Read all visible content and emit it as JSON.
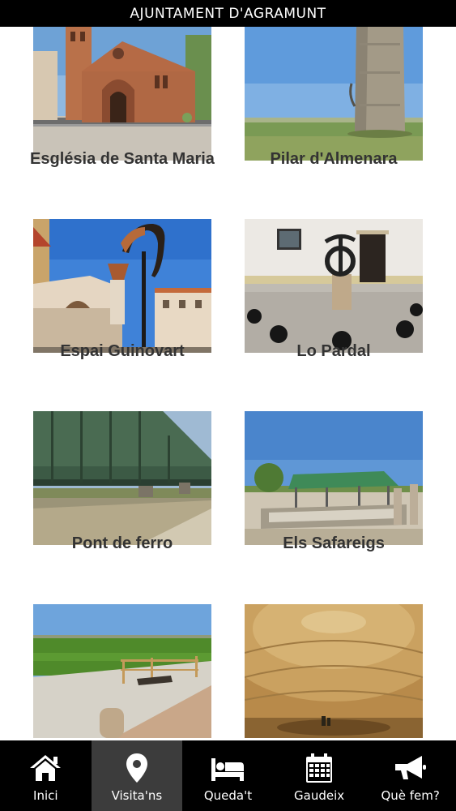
{
  "header": {
    "title": "AJUNTAMENT D'AGRAMUNT"
  },
  "places": [
    {
      "title": "Església de Santa Maria",
      "image_icon": "church-photo"
    },
    {
      "title": "Pilar d'Almenara",
      "image_icon": "tower-photo"
    },
    {
      "title": "Espai Guinovart",
      "image_icon": "sculpture-building-photo"
    },
    {
      "title": "Lo Pardal",
      "image_icon": "sculpture-plaza-photo"
    },
    {
      "title": "Pont de ferro",
      "image_icon": "iron-bridge-photo"
    },
    {
      "title": "Els Safareigs",
      "image_icon": "wash-house-photo"
    },
    {
      "title": "",
      "image_icon": "excavation-site-photo"
    },
    {
      "title": "",
      "image_icon": "ice-well-dome-photo"
    }
  ],
  "tabs": [
    {
      "label": "Inici",
      "icon": "home-icon",
      "active": false
    },
    {
      "label": "Visita'ns",
      "icon": "map-marker-icon",
      "active": true
    },
    {
      "label": "Queda't",
      "icon": "bed-icon",
      "active": false
    },
    {
      "label": "Gaudeix",
      "icon": "calendar-icon",
      "active": false
    },
    {
      "label": "Què fem?",
      "icon": "megaphone-icon",
      "active": false
    }
  ],
  "colors": {
    "header_bg": "#000000",
    "tabbar_bg": "#000000",
    "tab_active_bg": "#3c3c3c",
    "title_text": "#333333"
  }
}
